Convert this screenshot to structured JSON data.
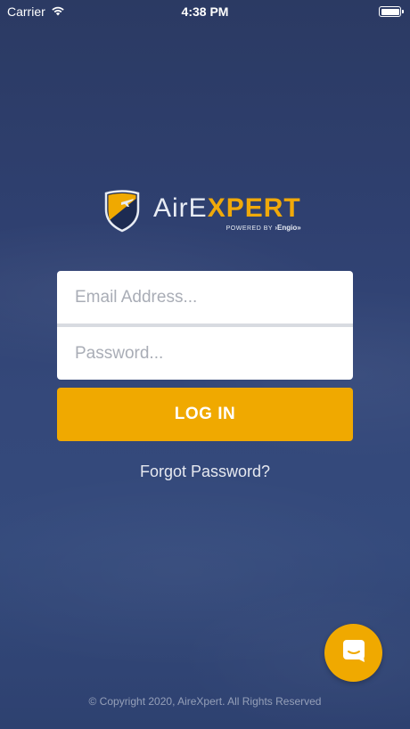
{
  "status_bar": {
    "carrier": "Carrier",
    "time": "4:38 PM",
    "icons": [
      "wifi-icon",
      "battery-icon"
    ]
  },
  "logo": {
    "aire": "AirE",
    "expert": "XPERT",
    "powered_by": "POWERED BY",
    "engio": "›Engio»",
    "icon": "shield-plane-icon"
  },
  "form": {
    "email_placeholder": "Email Address...",
    "password_placeholder": "Password...",
    "login_label": "LOG IN",
    "forgot_label": "Forgot Password?"
  },
  "chat": {
    "icon": "chat-icon"
  },
  "footer": {
    "copyright": "© Copyright 2020, AireXpert. All Rights Reserved"
  },
  "colors": {
    "accent": "#f0a900",
    "background": "#2f4070",
    "input_bg": "#ffffff"
  }
}
